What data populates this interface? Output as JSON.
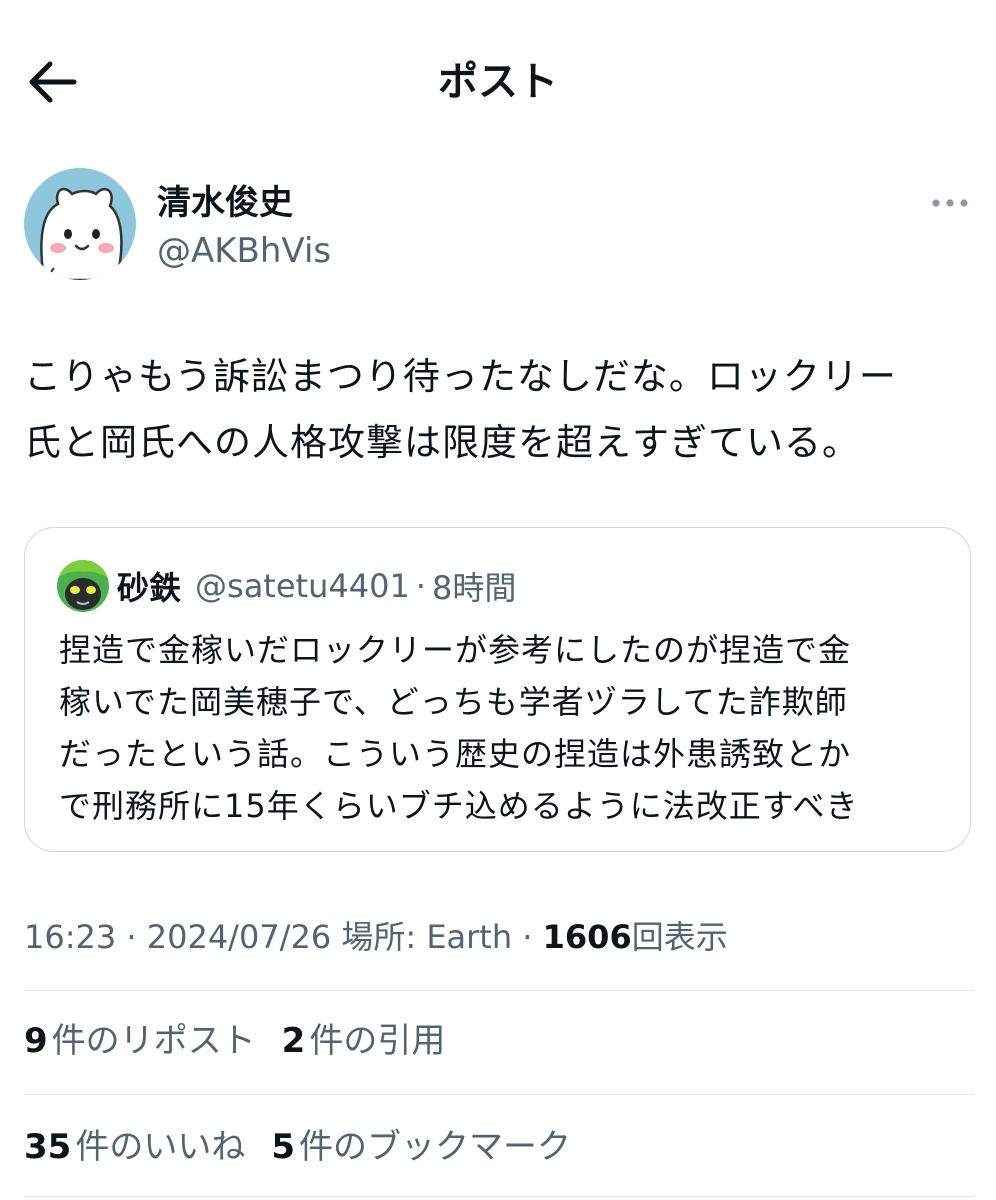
{
  "header": {
    "title": "ポスト",
    "back_icon": "arrow-left-icon"
  },
  "author": {
    "name": "清水俊史",
    "handle": "@AKBhVis",
    "avatar_icon": "bear-avatar"
  },
  "more_icon": "ellipsis-icon",
  "post": {
    "line1": "こりゃもう訴訟まつり待ったなしだな。ロックリー",
    "line2": "氏と岡氏への人格攻撃は限度を超えすぎている。"
  },
  "quote": {
    "name": "砂鉄",
    "handle": "@satetu4401",
    "separator": "·",
    "time": "8時間",
    "avatar_icon": "alien-avatar",
    "lines": [
      "捏造で金稼いだロックリーが参考にしたのが捏造で金",
      "稼いでた岡美穂子で、どっちも学者ヅラしてた詐欺師",
      "だったという話。こういう歴史の捏造は外患誘致とか",
      "で刑務所に15年くらいブチ込めるように法改正すべき"
    ]
  },
  "meta": {
    "time": "16:23",
    "sep": " · ",
    "date": "2024/07/26",
    "location_label": "場所: ",
    "location": "Earth",
    "views_count": "1606",
    "views_label": "回表示"
  },
  "stats": {
    "reposts_count": "9",
    "reposts_label": "件のリポスト",
    "quotes_count": "2",
    "quotes_label": "件の引用",
    "likes_count": "35",
    "likes_label": "件のいいね",
    "bookmarks_count": "5",
    "bookmarks_label": "件のブックマーク"
  },
  "colors": {
    "text": "#0f1419",
    "secondary": "#536471",
    "border": "#cfd9de",
    "avatar_bg": "#8dc6dd"
  }
}
